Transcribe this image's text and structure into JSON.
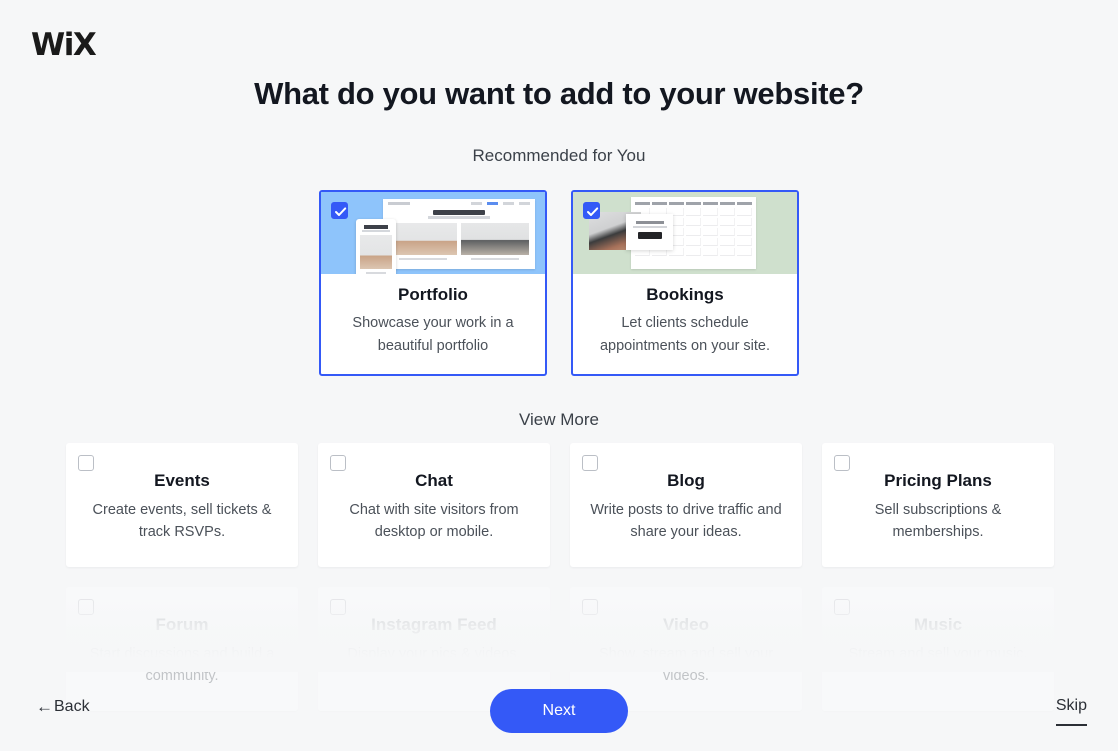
{
  "brand": {
    "logo_text": "WiX",
    "accent_color": "#3459f7"
  },
  "header": {
    "title": "What do you want to add to your website?"
  },
  "sections": {
    "recommended_label": "Recommended for You",
    "view_more_label": "View More"
  },
  "recommended": [
    {
      "name": "Portfolio",
      "description": "Showcase your work in a beautiful portfolio",
      "checked": true,
      "thumb_color": "#8ec4fb",
      "thumb_texts": {
        "site_title": "My Portfolio",
        "caption_left": "The Sahara",
        "caption_right": "Lighthouse by the Sea"
      }
    },
    {
      "name": "Bookings",
      "description": "Let clients schedule appointments on your site.",
      "checked": true,
      "thumb_color": "#cfe0cd",
      "thumb_texts": {
        "site_title": "",
        "caption_left": "",
        "caption_right": ""
      }
    }
  ],
  "view_more": [
    {
      "name": "Events",
      "description": "Create events, sell tickets & track RSVPs.",
      "checked": false,
      "faded": false
    },
    {
      "name": "Chat",
      "description": "Chat with site visitors from desktop or mobile.",
      "checked": false,
      "faded": false
    },
    {
      "name": "Blog",
      "description": "Write posts to drive traffic and share your ideas.",
      "checked": false,
      "faded": false
    },
    {
      "name": "Pricing Plans",
      "description": "Sell subscriptions & memberships.",
      "checked": false,
      "faded": false
    },
    {
      "name": "Forum",
      "description": "Start discussions and build a community.",
      "checked": false,
      "faded": true
    },
    {
      "name": "Instagram Feed",
      "description": "Display your pics & videos.",
      "checked": false,
      "faded": true
    },
    {
      "name": "Video",
      "description": "Show, stream and sell your videos.",
      "checked": false,
      "faded": true
    },
    {
      "name": "Music",
      "description": "Stream and sell your music.",
      "checked": false,
      "faded": true
    }
  ],
  "footer": {
    "back_label": "Back",
    "back_arrow": "←",
    "next_label": "Next",
    "skip_label": "Skip"
  }
}
